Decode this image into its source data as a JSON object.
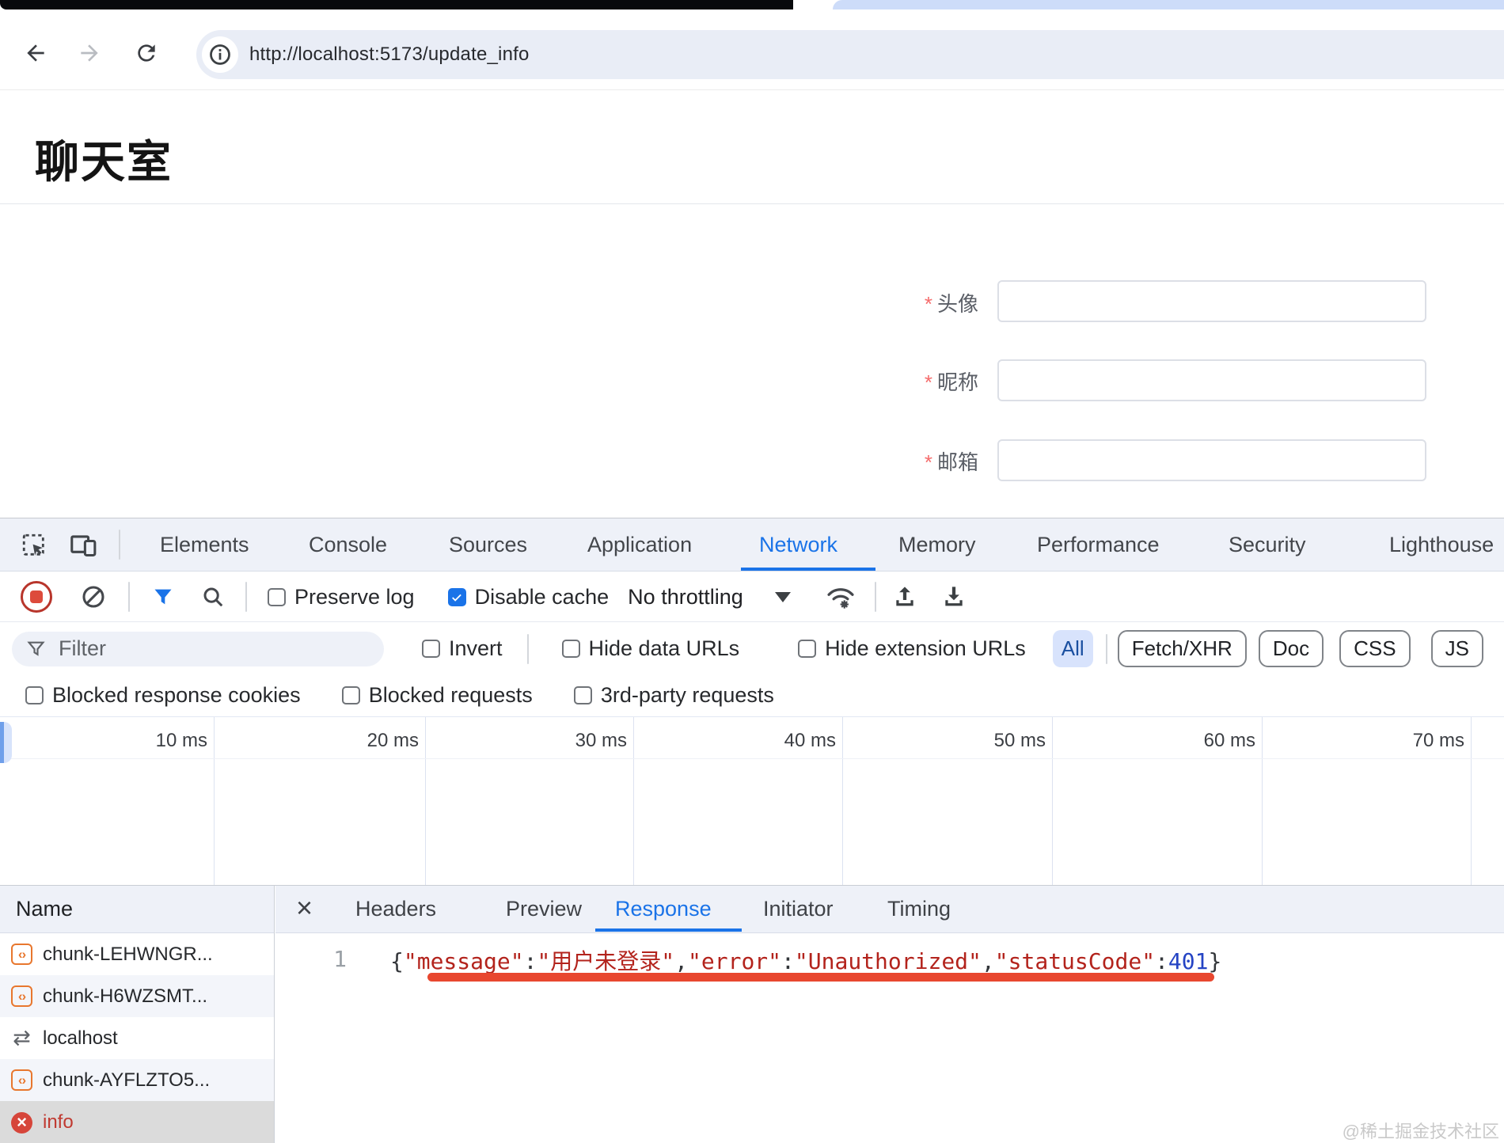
{
  "colors": {
    "accent_blue": "#1a73e8",
    "record_red": "#b8352b",
    "annotation_red": "#e8472f",
    "json_string": "#b3231c",
    "json_number": "#2544c4",
    "error_text": "#c03a31",
    "required_red": "#f56c6c",
    "script_icon_orange": "#e8772e"
  },
  "icons": {
    "close": "×",
    "script": "‹›",
    "exchange": "⇄",
    "error_x": "×"
  },
  "browser": {
    "url": "http://localhost:5173/update_info"
  },
  "page": {
    "title": "聊天室",
    "form": {
      "required_marker": "*",
      "fields": [
        {
          "label": "头像",
          "value": ""
        },
        {
          "label": "昵称",
          "value": ""
        },
        {
          "label": "邮箱",
          "value": ""
        }
      ]
    }
  },
  "devtools": {
    "tabs": [
      "Elements",
      "Console",
      "Sources",
      "Application",
      "Network",
      "Memory",
      "Performance",
      "Security",
      "Lighthouse"
    ],
    "active_tab": "Network",
    "network_toolbar": {
      "preserve_log": "Preserve log",
      "disable_cache": "Disable cache",
      "throttling_value": "No throttling"
    },
    "filter_bar": {
      "placeholder": "Filter",
      "value": "",
      "invert_label": "Invert",
      "hide_data_urls": "Hide data URLs",
      "hide_extension_urls": "Hide extension URLs",
      "type_filters": [
        "All",
        "Fetch/XHR",
        "Doc",
        "CSS",
        "JS"
      ],
      "active_type_filter": "All"
    },
    "options_row": [
      "Blocked response cookies",
      "Blocked requests",
      "3rd-party requests"
    ],
    "timeline_ticks": [
      "10 ms",
      "20 ms",
      "30 ms",
      "40 ms",
      "50 ms",
      "60 ms",
      "70 ms"
    ],
    "requests": {
      "header": "Name",
      "rows": [
        {
          "name": "chunk-LEHWNGR...",
          "type": "script"
        },
        {
          "name": "chunk-H6WZSMT...",
          "type": "script"
        },
        {
          "name": "localhost",
          "type": "exchange"
        },
        {
          "name": "chunk-AYFLZTO5...",
          "type": "script"
        },
        {
          "name": "info",
          "type": "error",
          "state": "selected"
        }
      ]
    },
    "detail": {
      "tabs": [
        "Headers",
        "Preview",
        "Response",
        "Initiator",
        "Timing"
      ],
      "active_tab": "Response",
      "line_number": "1",
      "response_segments": [
        {
          "text": "{",
          "type": "punctuation"
        },
        {
          "text": "\"message\"",
          "type": "string"
        },
        {
          "text": ":",
          "type": "punctuation"
        },
        {
          "text": "\"用户未登录\"",
          "type": "string"
        },
        {
          "text": ",",
          "type": "punctuation"
        },
        {
          "text": "\"error\"",
          "type": "string"
        },
        {
          "text": ":",
          "type": "punctuation"
        },
        {
          "text": "\"Unauthorized\"",
          "type": "string"
        },
        {
          "text": ",",
          "type": "punctuation"
        },
        {
          "text": "\"statusCode\"",
          "type": "string"
        },
        {
          "text": ":",
          "type": "punctuation"
        },
        {
          "text": "401",
          "type": "number"
        },
        {
          "text": "}",
          "type": "punctuation"
        }
      ]
    }
  },
  "watermark": "@稀土掘金技术社区"
}
